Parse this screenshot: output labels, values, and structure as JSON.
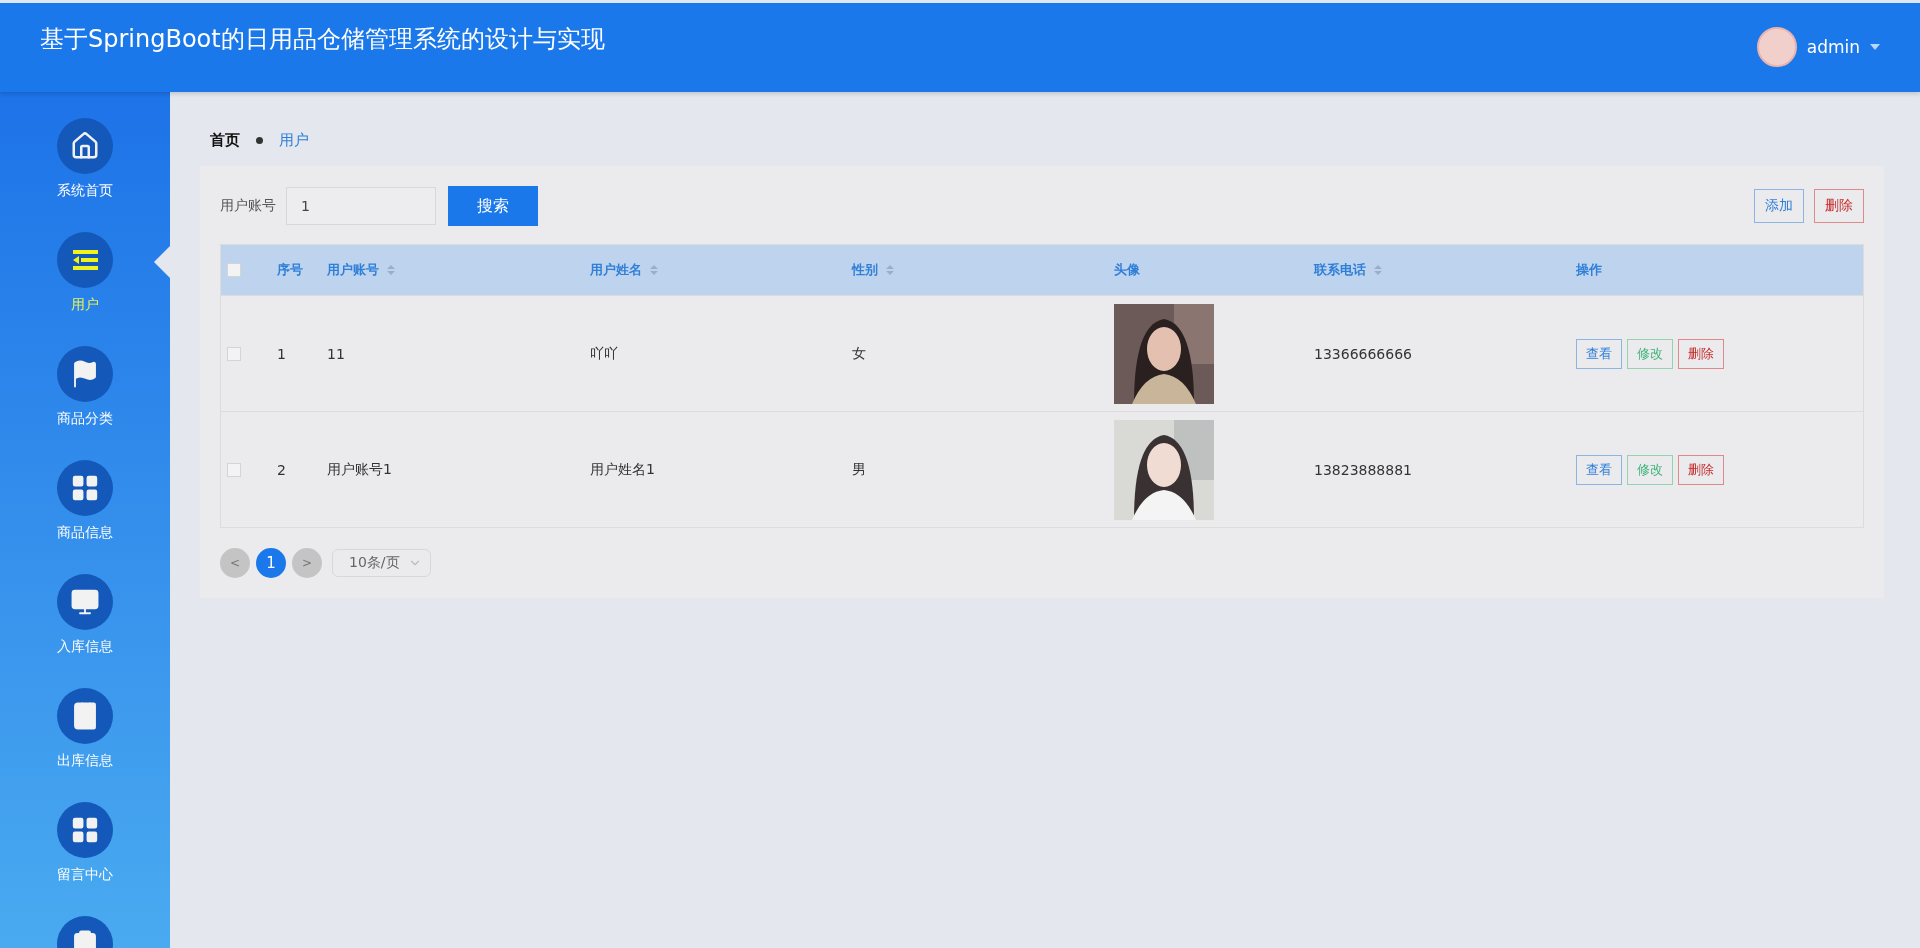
{
  "header": {
    "title": "基于SpringBoot的日用品仓储管理系统的设计与实现",
    "user": {
      "name": "admin"
    }
  },
  "sidebar": {
    "items": [
      {
        "label": "系统首页",
        "selected": false
      },
      {
        "label": "用户",
        "selected": true
      },
      {
        "label": "商品分类",
        "selected": false
      },
      {
        "label": "商品信息",
        "selected": false
      },
      {
        "label": "入库信息",
        "selected": false
      },
      {
        "label": "出库信息",
        "selected": false
      },
      {
        "label": "留言中心",
        "selected": false
      },
      {
        "selected": false
      }
    ]
  },
  "breadcrumb": [
    {
      "label": "首页",
      "selected": false
    },
    {
      "label": "用户",
      "selected": true
    }
  ],
  "search": {
    "label": "用户账号",
    "value": "1",
    "button": "搜索"
  },
  "toolbar": [
    {
      "label": "添加",
      "kind": "primary"
    },
    {
      "label": "删除",
      "kind": "danger"
    }
  ],
  "table": {
    "all_checked": false,
    "columns": [
      {
        "label": "序号",
        "sortable": false
      },
      {
        "label": "用户账号",
        "sortable": true
      },
      {
        "label": "用户姓名",
        "sortable": true
      },
      {
        "label": "性别",
        "sortable": true
      },
      {
        "label": "头像",
        "sortable": false
      },
      {
        "label": "联系电话",
        "sortable": true
      },
      {
        "label": "操作",
        "sortable": false
      }
    ],
    "rows": [
      {
        "checked": false,
        "index": "1",
        "account": "11",
        "name": "吖吖",
        "gender": "女",
        "phone": "13366666666",
        "actions": [
          {
            "label": "查看",
            "kind": "view"
          },
          {
            "label": "修改",
            "kind": "edit"
          },
          {
            "label": "删除",
            "kind": "delete"
          }
        ]
      },
      {
        "checked": false,
        "index": "2",
        "account": "用户账号1",
        "name": "用户姓名1",
        "gender": "男",
        "phone": "13823888881",
        "actions": [
          {
            "label": "查看",
            "kind": "view"
          },
          {
            "label": "修改",
            "kind": "edit"
          },
          {
            "label": "删除",
            "kind": "delete"
          }
        ]
      }
    ]
  },
  "pagination": {
    "prev": "<",
    "pages": [
      {
        "label": "1",
        "selected": true
      }
    ],
    "next": ">",
    "page_size": "10条/页"
  }
}
